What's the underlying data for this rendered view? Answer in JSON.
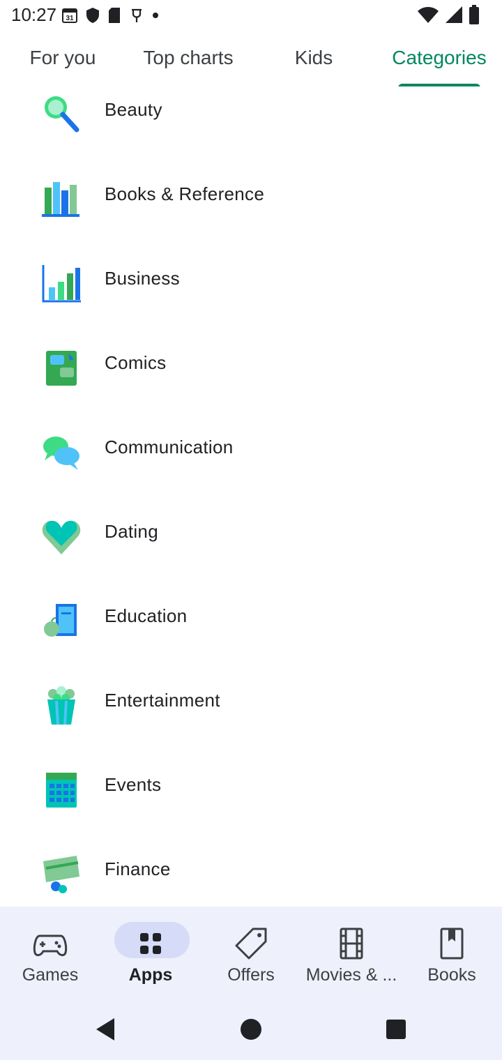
{
  "status_bar": {
    "time": "10:27",
    "left_icons": [
      "calendar-icon",
      "shield-icon",
      "sd-card-icon",
      "usb-icon",
      "dot-icon"
    ],
    "calendar_day": "31",
    "right_icons": [
      "wifi-icon",
      "signal-icon",
      "battery-icon"
    ]
  },
  "tabs": [
    {
      "label": "For you",
      "active": false
    },
    {
      "label": "Top charts",
      "active": false
    },
    {
      "label": "Kids",
      "active": false
    },
    {
      "label": "Categories",
      "active": true
    }
  ],
  "accent_color": "#01875f",
  "categories": [
    {
      "label": "Beauty",
      "icon": "beauty-mirror-icon"
    },
    {
      "label": "Books & Reference",
      "icon": "books-icon"
    },
    {
      "label": "Business",
      "icon": "business-chart-icon"
    },
    {
      "label": "Comics",
      "icon": "comics-icon"
    },
    {
      "label": "Communication",
      "icon": "chat-bubbles-icon"
    },
    {
      "label": "Dating",
      "icon": "heart-icon"
    },
    {
      "label": "Education",
      "icon": "education-icon"
    },
    {
      "label": "Entertainment",
      "icon": "popcorn-icon"
    },
    {
      "label": "Events",
      "icon": "calendar-grid-icon"
    },
    {
      "label": "Finance",
      "icon": "finance-card-icon"
    }
  ],
  "bottom_nav": [
    {
      "label": "Games",
      "icon": "gamepad-icon",
      "active": false
    },
    {
      "label": "Apps",
      "icon": "apps-grid-icon",
      "active": true
    },
    {
      "label": "Offers",
      "icon": "tag-icon",
      "active": false
    },
    {
      "label": "Movies & ...",
      "icon": "film-icon",
      "active": false
    },
    {
      "label": "Books",
      "icon": "bookmark-icon",
      "active": false
    }
  ],
  "system_nav": [
    "back-icon",
    "home-icon",
    "recents-icon"
  ]
}
